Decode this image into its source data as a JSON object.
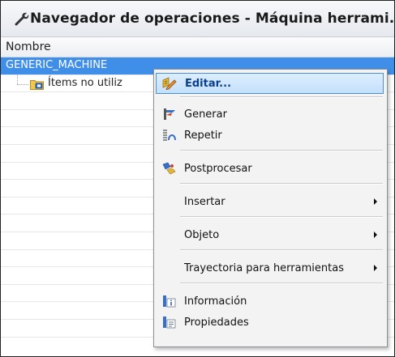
{
  "window": {
    "title": "Navegador de operaciones - Máquina herrami...",
    "icon": "wrench-icon"
  },
  "column_header": "Nombre",
  "tree": {
    "root": "GENERIC_MACHINE",
    "child": "Ítems no utiliz"
  },
  "context_menu": {
    "items": [
      {
        "label": "Editar...",
        "icon": "edit-icon",
        "highlighted": true
      },
      {
        "label": "Generar",
        "icon": "generate-icon"
      },
      {
        "label": "Repetir",
        "icon": "repeat-icon"
      },
      {
        "label": "Postprocesar",
        "icon": "postprocess-icon"
      },
      {
        "label": "Insertar",
        "submenu": true
      },
      {
        "label": "Objeto",
        "submenu": true
      },
      {
        "label": "Trayectoria para herramientas",
        "submenu": true
      },
      {
        "label": "Información",
        "icon": "info-icon"
      },
      {
        "label": "Propiedades",
        "icon": "properties-icon"
      }
    ]
  },
  "colors": {
    "selection": "#3f8ee8",
    "menu_highlight_border": "#4a8ed6",
    "menu_highlight_text": "#0a3f8f"
  }
}
